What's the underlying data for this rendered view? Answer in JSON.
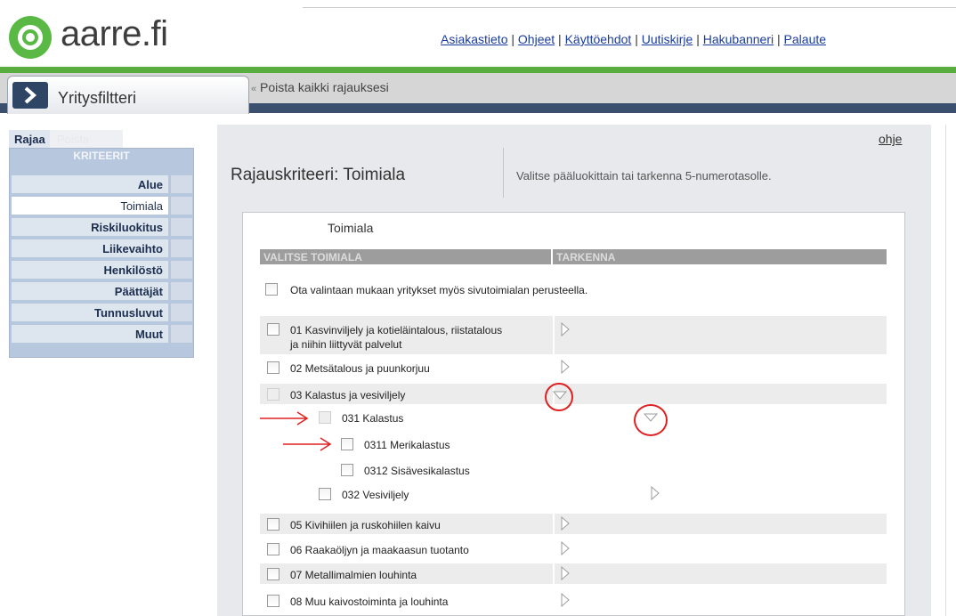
{
  "brand": {
    "name": "aarre.fi",
    "color": "#5ab845"
  },
  "top_links": [
    "Asiakastieto",
    "Ohjeet",
    "Käyttöehdot",
    "Uutiskirje",
    "Hakubanneri",
    "Palaute"
  ],
  "link_separator": " | ",
  "filter_tab": {
    "label": "Yritysfiltteri"
  },
  "remove_all": {
    "prefix": "«",
    "label": "Poista kaikki rajauksesi"
  },
  "left_tabs": {
    "rajaa": "Rajaa",
    "poista": "Poista"
  },
  "criteria": {
    "heading": "KRITEERIT",
    "items": [
      "Alue",
      "Toimiala",
      "Riskiluokitus",
      "Liikevaihto",
      "Henkilöstö",
      "Päättäjät",
      "Tunnusluvut",
      "Muut"
    ],
    "active": "Toimiala"
  },
  "help_link": "ohje",
  "section": {
    "title": "Rajauskriteeri: Toimiala",
    "description": "Valitse pääluokittain tai tarkenna 5-numerotasolle."
  },
  "panel": {
    "title": "Toimiala",
    "col_select": "VALITSE TOIMIALA",
    "col_refine": "TARKENNA",
    "secondary_option": "Ota valintaan mukaan yritykset myös sivutoimialan perusteella."
  },
  "industries": [
    {
      "line1": "01 Kasvinviljely ja kotieläintalous, riistatalous",
      "line2": "ja niihin liittyvät palvelut"
    },
    {
      "line1": "02 Metsätalous ja puunkorjuu"
    },
    {
      "line1": "03 Kalastus ja vesiviljely"
    },
    {
      "line1": "031 Kalastus"
    },
    {
      "line1": "0311 Merikalastus"
    },
    {
      "line1": "0312 Sisävesikalastus"
    },
    {
      "line1": "032 Vesiviljely"
    },
    {
      "line1": "05 Kivihiilen ja ruskohiilen kaivu"
    },
    {
      "line1": "06 Raakaöljyn ja maakaasun tuotanto"
    },
    {
      "line1": "07 Metallimalmien louhinta"
    },
    {
      "line1": "08 Muu kaivostoiminta ja louhinta"
    }
  ],
  "annotation_color": "#e02020"
}
